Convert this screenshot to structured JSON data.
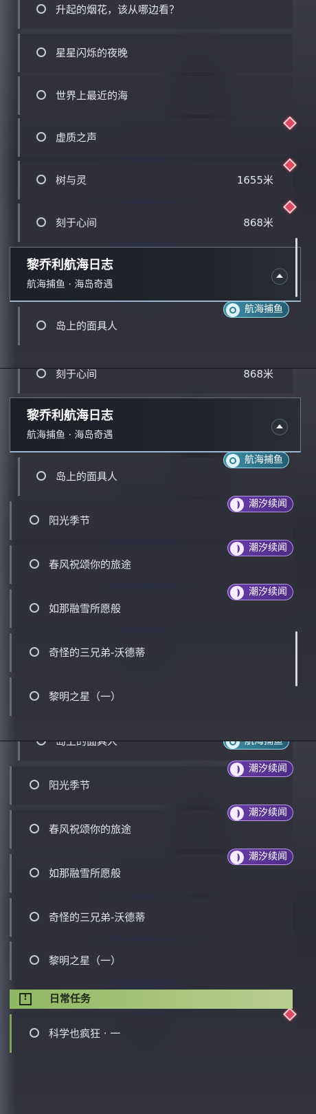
{
  "quests": {
    "fireworks": "升起的烟花，该从哪边看？",
    "starry_night": "星星闪烁的夜晚",
    "nearest_sea": "世界上最近的海",
    "void_voice": "虚质之声",
    "tree_spirit": "树与灵",
    "tree_spirit_distance": "1655米",
    "engraved_heart": "刻于心间",
    "engraved_heart_distance": "868米",
    "island_mask": "岛上的面具人",
    "sunshine_season": "阳光季节",
    "spring_wind": "春风祝颂你的旅途",
    "snow_wish": "如那融雪所愿般",
    "three_brothers": "奇怪的三兄弟-沃德蒂",
    "dawn_star": "黎明之星（一）",
    "science_madness": "科学也疯狂 · 一"
  },
  "group": {
    "title": "黎乔利航海日志",
    "subtitle": "航海捕鱼 · 海岛奇遇"
  },
  "tags": {
    "fishing": "航海捕鱼",
    "tide": "潮汐续闻"
  },
  "daily": {
    "label": "日常任务"
  },
  "icons": {
    "status": "circle-icon",
    "tracked": "diamond-marker-icon",
    "fishing": "fishing-hook-icon",
    "tide": "tide-icon",
    "daily": "exclamation-icon",
    "collapse": "chevron-up-icon"
  },
  "colors": {
    "tracked": "#d84a60",
    "fishing_tag": "#3e8ea3",
    "tide_tag": "#6a3da8",
    "daily_header": "#9cbf6e"
  }
}
